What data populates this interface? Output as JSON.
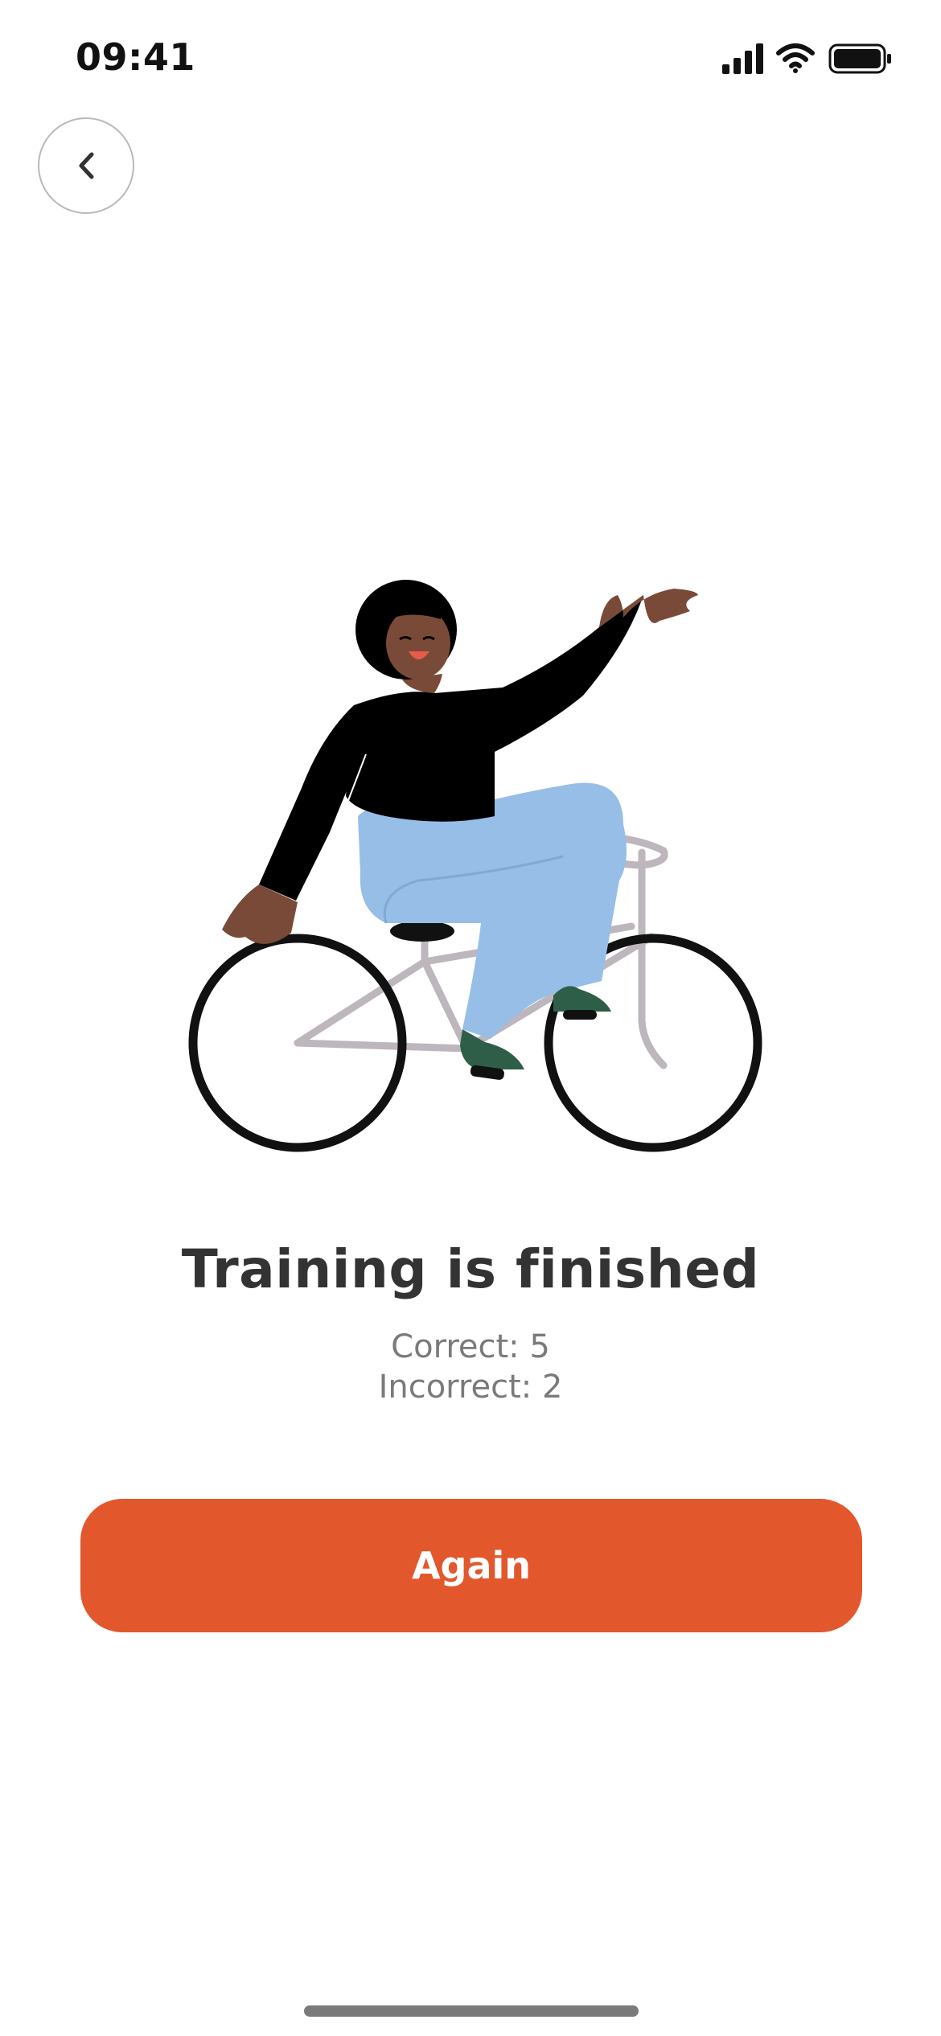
{
  "status_bar": {
    "time": "09:41",
    "icons": [
      "cellular-signal-icon",
      "wifi-icon",
      "battery-icon"
    ]
  },
  "navigation": {
    "back_icon": "chevron-left-icon"
  },
  "illustration": {
    "subject": "person-riding-bicycle-waving"
  },
  "result": {
    "title": "Training is finished",
    "correct": "Correct: 5",
    "incorrect": "Incorrect: 2"
  },
  "actions": {
    "again_label": "Again"
  },
  "colors": {
    "accent": "#e2572b",
    "title_text": "#333333",
    "secondary_text": "#7a7a7a",
    "background": "#ffffff"
  }
}
